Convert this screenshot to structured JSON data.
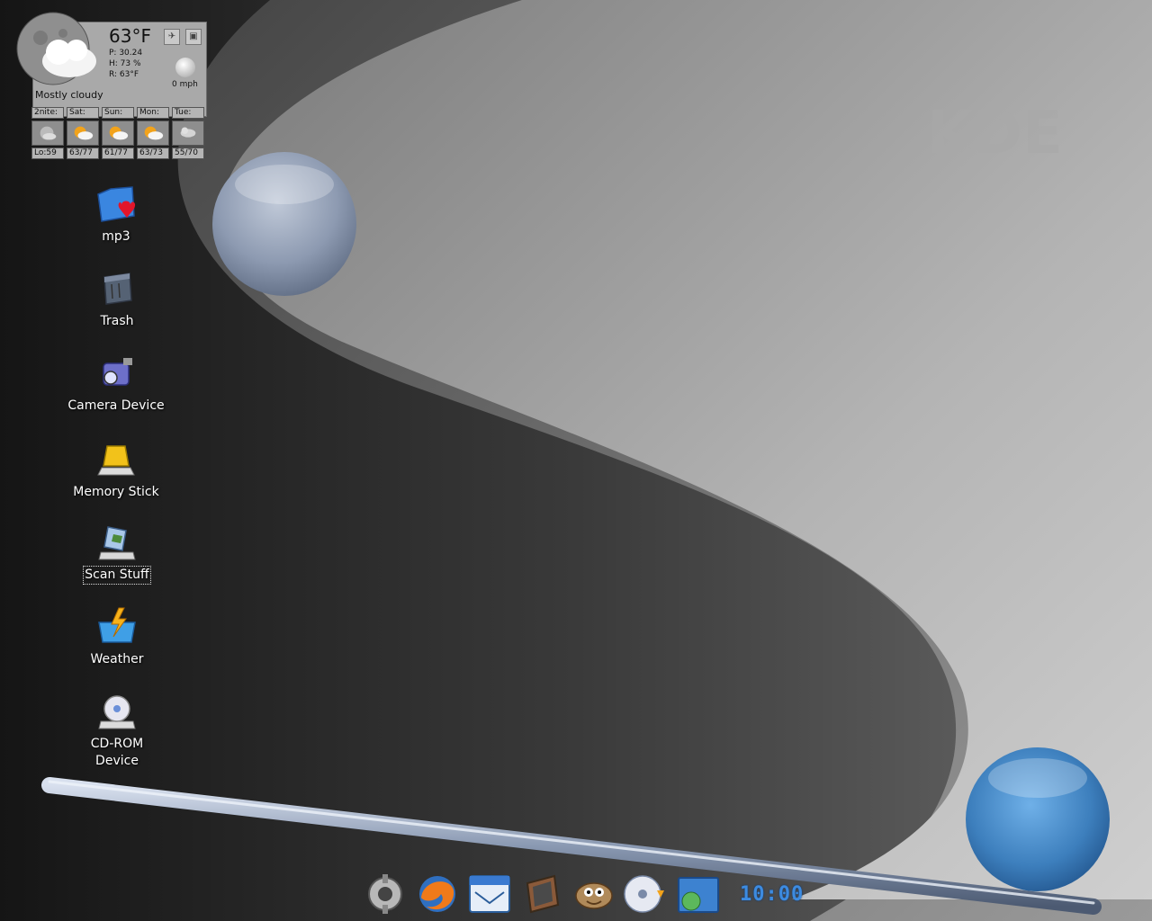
{
  "wallpaper": {
    "watermark": "KDE",
    "colors": {
      "dark": "#1e1e1e",
      "light": "#bdbdbd",
      "sphere_gray": "#8f9cb2",
      "sphere_blue": "#3f82bf"
    }
  },
  "weather": {
    "temperature": "63°F",
    "pressure": "P:  30.24",
    "humidity": "H:  73 %",
    "realfeel": "R:  63°F",
    "wind": "0 mph",
    "condition": "Mostly cloudy",
    "forecast": [
      {
        "day": "2nite:",
        "range": "Lo:59",
        "icon": "moon-cloud-icon"
      },
      {
        "day": "Sat:",
        "range": "63/77",
        "icon": "sun-cloud-icon"
      },
      {
        "day": "Sun:",
        "range": "61/77",
        "icon": "sun-cloud-icon"
      },
      {
        "day": "Mon:",
        "range": "63/73",
        "icon": "sun-cloud-icon"
      },
      {
        "day": "Tue:",
        "range": "55/70",
        "icon": "cloud-icon"
      }
    ]
  },
  "desktop_icons": [
    {
      "label": "mp3",
      "icon": "favorite-folder-icon"
    },
    {
      "label": "Trash",
      "icon": "trash-icon"
    },
    {
      "label": "Camera Device",
      "icon": "camera-icon"
    },
    {
      "label": "Memory Stick",
      "icon": "memory-stick-icon"
    },
    {
      "label": "Scan Stuff",
      "icon": "scanner-icon"
    },
    {
      "label": "Weather",
      "icon": "weather-folder-icon"
    },
    {
      "label": "CD-ROM Device",
      "icon": "cdrom-icon"
    }
  ],
  "taskbar": {
    "items": [
      {
        "icon": "kde-menu-icon"
      },
      {
        "icon": "firefox-icon"
      },
      {
        "icon": "mail-calendar-icon"
      },
      {
        "icon": "konsole-icon"
      },
      {
        "icon": "gimp-icon"
      },
      {
        "icon": "cd-burner-icon"
      },
      {
        "icon": "file-manager-icon"
      }
    ],
    "clock": "10:00"
  }
}
